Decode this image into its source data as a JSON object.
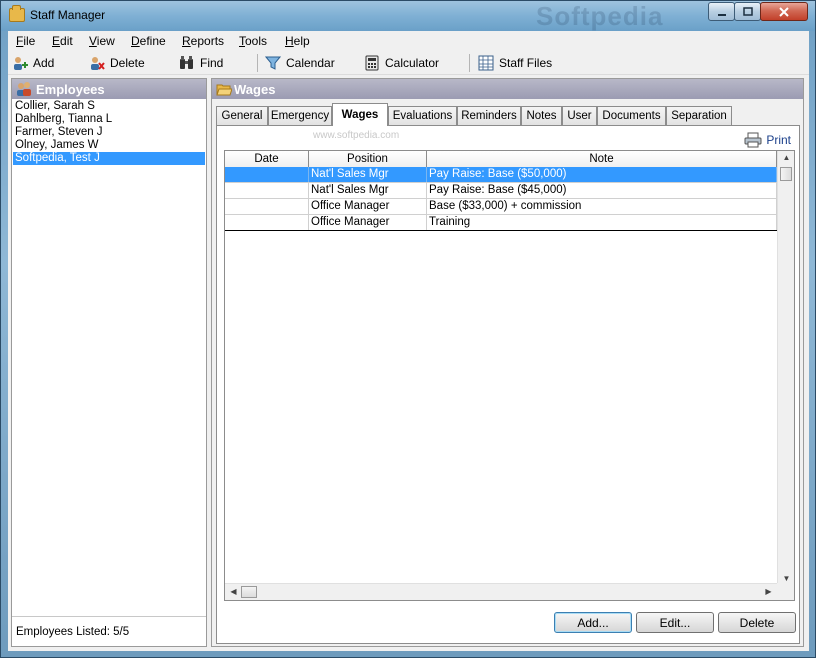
{
  "window": {
    "title": "Staff Manager",
    "watermark": "Softpedia"
  },
  "menu": [
    "File",
    "Edit",
    "View",
    "Define",
    "Reports",
    "Tools",
    "Help"
  ],
  "toolbar": {
    "add": "Add",
    "delete": "Delete",
    "find": "Find",
    "calendar": "Calendar",
    "calculator": "Calculator",
    "staff_files": "Staff Files"
  },
  "employees": {
    "header": "Employees",
    "items": [
      {
        "name": "Collier, Sarah S",
        "selected": false
      },
      {
        "name": "Dahlberg, Tianna L",
        "selected": false
      },
      {
        "name": "Farmer, Steven J",
        "selected": false
      },
      {
        "name": "Olney, James W",
        "selected": false
      },
      {
        "name": "Softpedia, Test J",
        "selected": true
      }
    ],
    "footer": "Employees Listed: 5/5"
  },
  "wages": {
    "header": "Wages",
    "tabs": [
      {
        "label": "General",
        "active": false
      },
      {
        "label": "Emergency",
        "active": false
      },
      {
        "label": "Wages",
        "active": true
      },
      {
        "label": "Evaluations",
        "active": false
      },
      {
        "label": "Reminders",
        "active": false
      },
      {
        "label": "Notes",
        "active": false
      },
      {
        "label": "User",
        "active": false
      },
      {
        "label": "Documents",
        "active": false
      },
      {
        "label": "Separation",
        "active": false
      }
    ],
    "watermark_url": "www.softpedia.com",
    "print_label": "Print",
    "columns": [
      "Date",
      "Position",
      "Note"
    ],
    "rows": [
      {
        "date": "",
        "position": "Nat'l Sales Mgr",
        "note": "Pay Raise: Base ($50,000)",
        "selected": true
      },
      {
        "date": "",
        "position": "Nat'l Sales Mgr",
        "note": "Pay Raise: Base ($45,000)",
        "selected": false
      },
      {
        "date": "",
        "position": "Office Manager",
        "note": "Base ($33,000) + commission",
        "selected": false
      },
      {
        "date": "",
        "position": "Office Manager",
        "note": "Training",
        "selected": false
      }
    ],
    "buttons": {
      "add": "Add...",
      "edit": "Edit...",
      "delete": "Delete"
    }
  }
}
